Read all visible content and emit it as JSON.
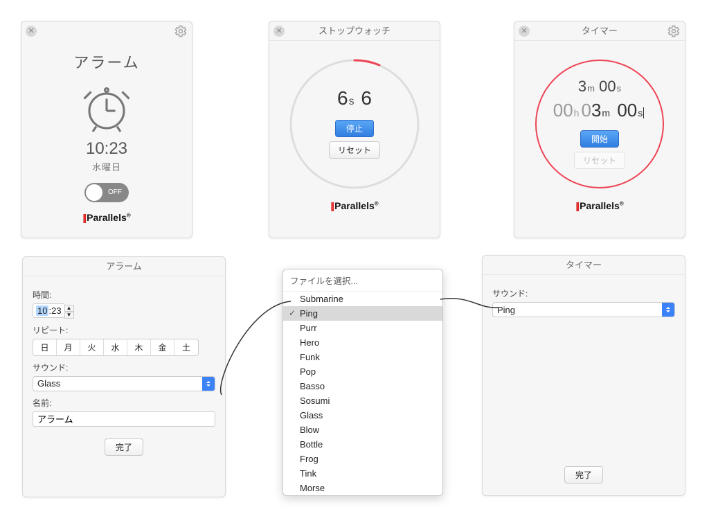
{
  "alarm_widget": {
    "title": "アラーム",
    "time": "10:23",
    "day": "水曜日",
    "toggle_label": "OFF",
    "brand": "Parallels"
  },
  "stopwatch_widget": {
    "title": "ストップウォッチ",
    "elapsed_sec": "6",
    "elapsed_sec_unit": "s",
    "elapsed_tenths": "6",
    "stop_label": "停止",
    "reset_label": "リセット",
    "brand": "Parallels"
  },
  "timer_widget": {
    "title": "タイマー",
    "display_min": "3",
    "display_min_unit": "m",
    "display_sec": "00",
    "display_sec_unit": "s",
    "edit_h": "00",
    "edit_h_unit": "h",
    "edit_m_prefix": "0",
    "edit_m": "3",
    "edit_m_unit": "m",
    "edit_s": "00",
    "edit_s_unit": "s",
    "start_label": "開始",
    "reset_label": "リセット",
    "brand": "Parallels"
  },
  "alarm_settings": {
    "title": "アラーム",
    "time_label": "時間:",
    "time_hh": "10",
    "time_mm": "23",
    "repeat_label": "リピート:",
    "days": [
      "日",
      "月",
      "火",
      "水",
      "木",
      "金",
      "土"
    ],
    "sound_label": "サウンド:",
    "sound_value": "Glass",
    "name_label": "名前:",
    "name_value": "アラーム",
    "done_label": "完了"
  },
  "sound_popup": {
    "title": "ファイルを選択...",
    "selected": "Ping",
    "items": [
      "Submarine",
      "Ping",
      "Purr",
      "Hero",
      "Funk",
      "Pop",
      "Basso",
      "Sosumi",
      "Glass",
      "Blow",
      "Bottle",
      "Frog",
      "Tink",
      "Morse"
    ]
  },
  "timer_settings": {
    "title": "タイマー",
    "sound_label": "サウンド:",
    "sound_value": "Ping",
    "done_label": "完了"
  }
}
